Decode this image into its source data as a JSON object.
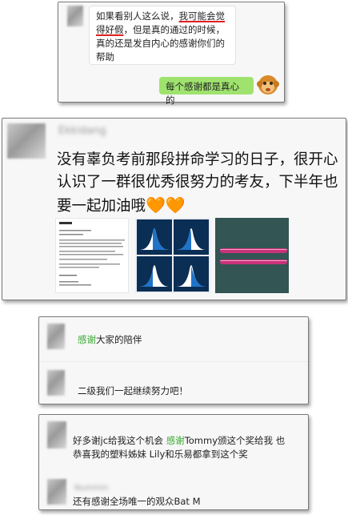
{
  "chat": {
    "incoming_pre": "如果看别人这么说，",
    "incoming_underlined_1": "我可能会觉",
    "incoming_underlined_2": "得好假",
    "incoming_post": "，但是真的通过的时候，真的还是发自内心的感谢你们的帮助",
    "outgoing": "每个感谢都是真心的"
  },
  "post": {
    "author": "Ekkidang",
    "text": "没有辜负考前那段拼命学习的日子，很开心认识了一群很优秀很努力的考友，下半年也要一起加油哦",
    "hearts": "🧡🧡"
  },
  "comments_a": [
    {
      "highlight": "感谢",
      "text": "大家的陪伴"
    },
    {
      "highlight": "",
      "text": "二级我们一起继续努力吧！"
    }
  ],
  "comments_b": [
    {
      "line1_pre": "好多谢jc给我这个机会 ",
      "highlight": "感谢",
      "line1_post": "Tommy颁这个奖给我 也",
      "line2": "恭喜我的塑料姊妹 Lily和乐易都拿到这个奖"
    },
    {
      "author": "Nummin",
      "highlight": "",
      "text": "还有感谢全场唯一的观众Bat M"
    }
  ],
  "colors": {
    "highlight": "#3aa835",
    "outgoing_bubble": "#9fe36e",
    "heart": "#f26b2a",
    "chart_blue": "#1f74c9"
  }
}
